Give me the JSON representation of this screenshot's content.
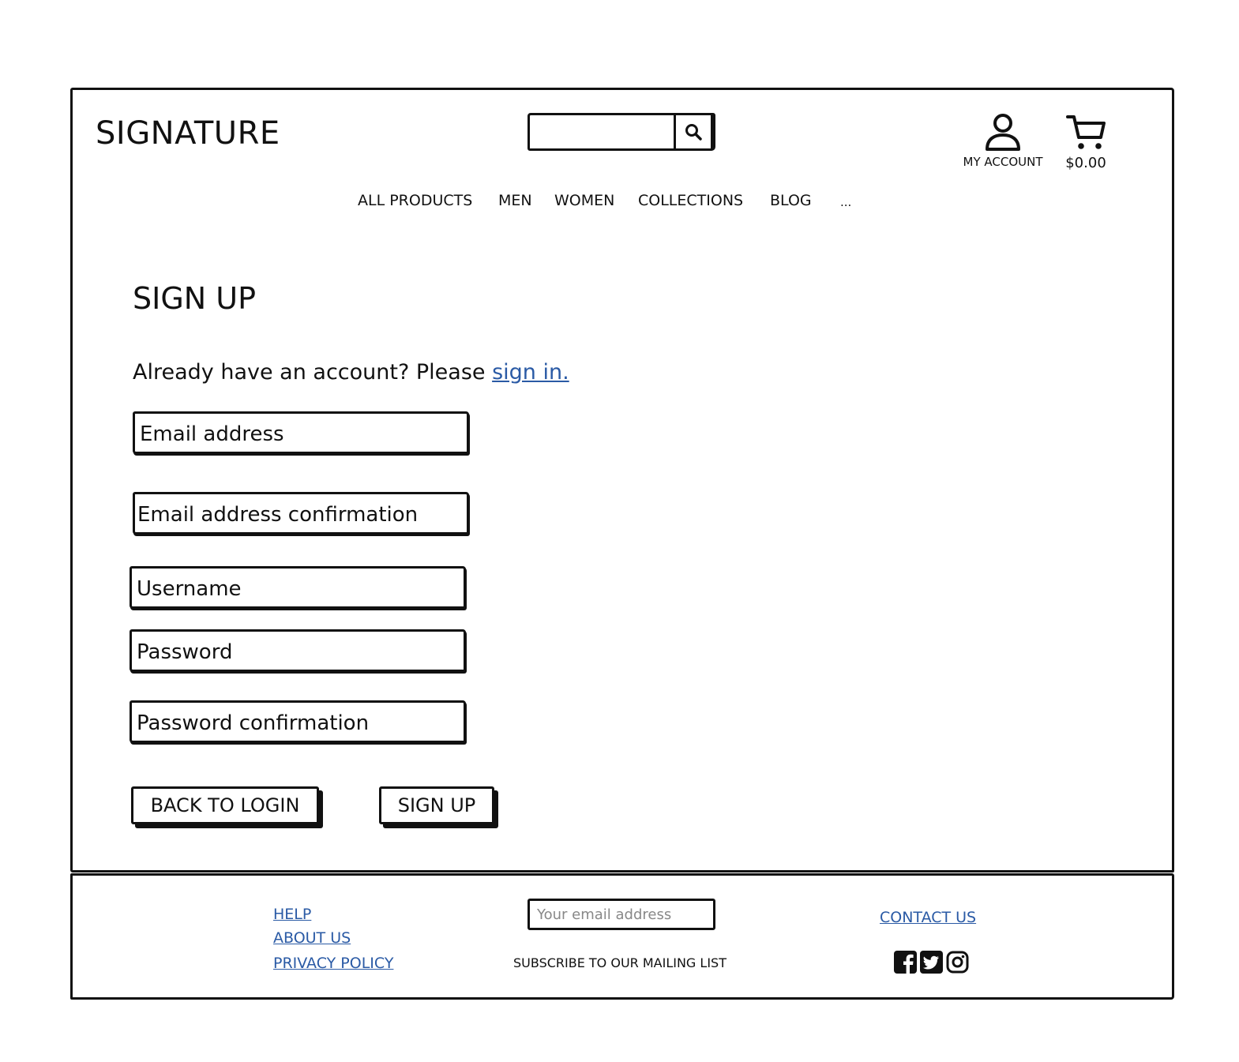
{
  "header": {
    "logo": "SIGNATURE",
    "search": {
      "placeholder": "",
      "value": ""
    },
    "account_label": "MY ACCOUNT",
    "cart_total": "$0.00"
  },
  "nav": {
    "items": [
      "ALL PRODUCTS",
      "MEN",
      "WOMEN",
      "COLLECTIONS",
      "BLOG",
      "..."
    ]
  },
  "main": {
    "title": "SIGN UP",
    "signin_prompt": "Already have an account? Please ",
    "signin_link": "sign in.",
    "fields": {
      "email": "Email address",
      "email_confirm": "Email address confirmation",
      "username": "Username",
      "password": "Password",
      "password_confirm": "Password confirmation"
    },
    "buttons": {
      "back": "BACK TO LOGIN",
      "signup": "SIGN UP"
    }
  },
  "footer": {
    "links": [
      "HELP",
      "ABOUT US",
      "PRIVACY POLICY"
    ],
    "newsletter_placeholder": "Your email address",
    "subscribe_label": "SUBSCRIBE TO OUR MAILING LIST",
    "contact": "CONTACT US",
    "social": [
      "facebook-icon",
      "twitter-icon",
      "instagram-icon"
    ],
    "link_color": "#2a5aa5"
  }
}
